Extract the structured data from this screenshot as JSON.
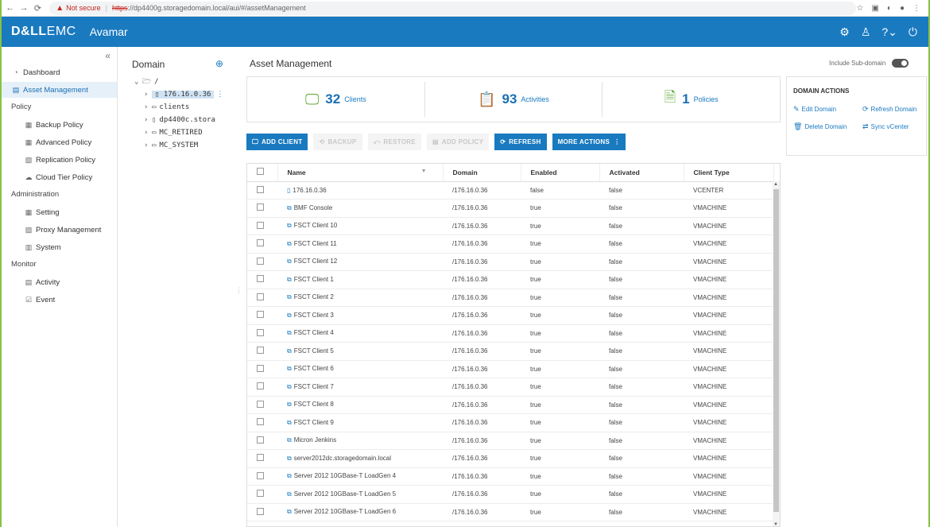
{
  "browser": {
    "not_secure": "Not secure",
    "url_scheme": "https",
    "url_rest": "://dp4400g.storagedomain.local/aui/#/assetManagement"
  },
  "app": {
    "brand_bold": "D&LL",
    "brand_light": "EMC",
    "name": "Avamar"
  },
  "sidebar": {
    "dashboard": "Dashboard",
    "asset_management": "Asset Management",
    "policy_section": "Policy",
    "backup_policy": "Backup Policy",
    "advanced_policy": "Advanced Policy",
    "replication_policy": "Replication Policy",
    "cloud_tier_policy": "Cloud Tier Policy",
    "administration_section": "Administration",
    "setting": "Setting",
    "proxy_management": "Proxy Management",
    "system": "System",
    "monitor_section": "Monitor",
    "activity": "Activity",
    "event": "Event"
  },
  "domain": {
    "title": "Domain",
    "root": "/",
    "selected": "176.16.0.36",
    "nodes": [
      "clients",
      "dp4400c.stora",
      "MC_RETIRED",
      "MC_SYSTEM"
    ]
  },
  "main": {
    "title": "Asset Management",
    "include_subdomain": "Include Sub-domain",
    "summary": {
      "clients_count": "32",
      "clients_label": "Clients",
      "activities_count": "93",
      "activities_label": "Activities",
      "policies_count": "1",
      "policies_label": "Policies"
    },
    "toolbar": {
      "add_client": "ADD CLIENT",
      "backup": "BACKUP",
      "restore": "RESTORE",
      "add_policy": "ADD POLICY",
      "refresh": "REFRESH",
      "more_actions": "MORE ACTIONS"
    },
    "columns": {
      "name": "Name",
      "domain": "Domain",
      "enabled": "Enabled",
      "activated": "Activated",
      "client_type": "Client Type"
    },
    "rows": [
      {
        "name": "176.16.0.36",
        "domain": "/176.16.0.36",
        "enabled": "false",
        "activated": "false",
        "type": "VCENTER"
      },
      {
        "name": "BMF Console",
        "domain": "/176.16.0.36",
        "enabled": "true",
        "activated": "false",
        "type": "VMACHINE"
      },
      {
        "name": "FSCT Client 10",
        "domain": "/176.16.0.36",
        "enabled": "true",
        "activated": "false",
        "type": "VMACHINE"
      },
      {
        "name": "FSCT Client 11",
        "domain": "/176.16.0.36",
        "enabled": "true",
        "activated": "false",
        "type": "VMACHINE"
      },
      {
        "name": "FSCT Client 12",
        "domain": "/176.16.0.36",
        "enabled": "true",
        "activated": "false",
        "type": "VMACHINE"
      },
      {
        "name": "FSCT Client 1",
        "domain": "/176.16.0.36",
        "enabled": "true",
        "activated": "false",
        "type": "VMACHINE"
      },
      {
        "name": "FSCT Client 2",
        "domain": "/176.16.0.36",
        "enabled": "true",
        "activated": "false",
        "type": "VMACHINE"
      },
      {
        "name": "FSCT Client 3",
        "domain": "/176.16.0.36",
        "enabled": "true",
        "activated": "false",
        "type": "VMACHINE"
      },
      {
        "name": "FSCT Client 4",
        "domain": "/176.16.0.36",
        "enabled": "true",
        "activated": "false",
        "type": "VMACHINE"
      },
      {
        "name": "FSCT Client 5",
        "domain": "/176.16.0.36",
        "enabled": "true",
        "activated": "false",
        "type": "VMACHINE"
      },
      {
        "name": "FSCT Client 6",
        "domain": "/176.16.0.36",
        "enabled": "true",
        "activated": "false",
        "type": "VMACHINE"
      },
      {
        "name": "FSCT Client 7",
        "domain": "/176.16.0.36",
        "enabled": "true",
        "activated": "false",
        "type": "VMACHINE"
      },
      {
        "name": "FSCT Client 8",
        "domain": "/176.16.0.36",
        "enabled": "true",
        "activated": "false",
        "type": "VMACHINE"
      },
      {
        "name": "FSCT Client 9",
        "domain": "/176.16.0.36",
        "enabled": "true",
        "activated": "false",
        "type": "VMACHINE"
      },
      {
        "name": "Micron Jenkins",
        "domain": "/176.16.0.36",
        "enabled": "true",
        "activated": "false",
        "type": "VMACHINE"
      },
      {
        "name": "server2012dc.storagedomain.local",
        "domain": "/176.16.0.36",
        "enabled": "true",
        "activated": "false",
        "type": "VMACHINE"
      },
      {
        "name": "Server 2012 10GBase-T LoadGen 4",
        "domain": "/176.16.0.36",
        "enabled": "true",
        "activated": "false",
        "type": "VMACHINE"
      },
      {
        "name": "Server 2012 10GBase-T LoadGen 5",
        "domain": "/176.16.0.36",
        "enabled": "true",
        "activated": "false",
        "type": "VMACHINE"
      },
      {
        "name": "Server 2012 10GBase-T LoadGen 6",
        "domain": "/176.16.0.36",
        "enabled": "true",
        "activated": "false",
        "type": "VMACHINE"
      }
    ]
  },
  "domain_actions": {
    "title": "DOMAIN ACTIONS",
    "edit": "Edit Domain",
    "refresh": "Refresh Domain",
    "delete": "Delete Domain",
    "sync": "Sync vCenter"
  }
}
